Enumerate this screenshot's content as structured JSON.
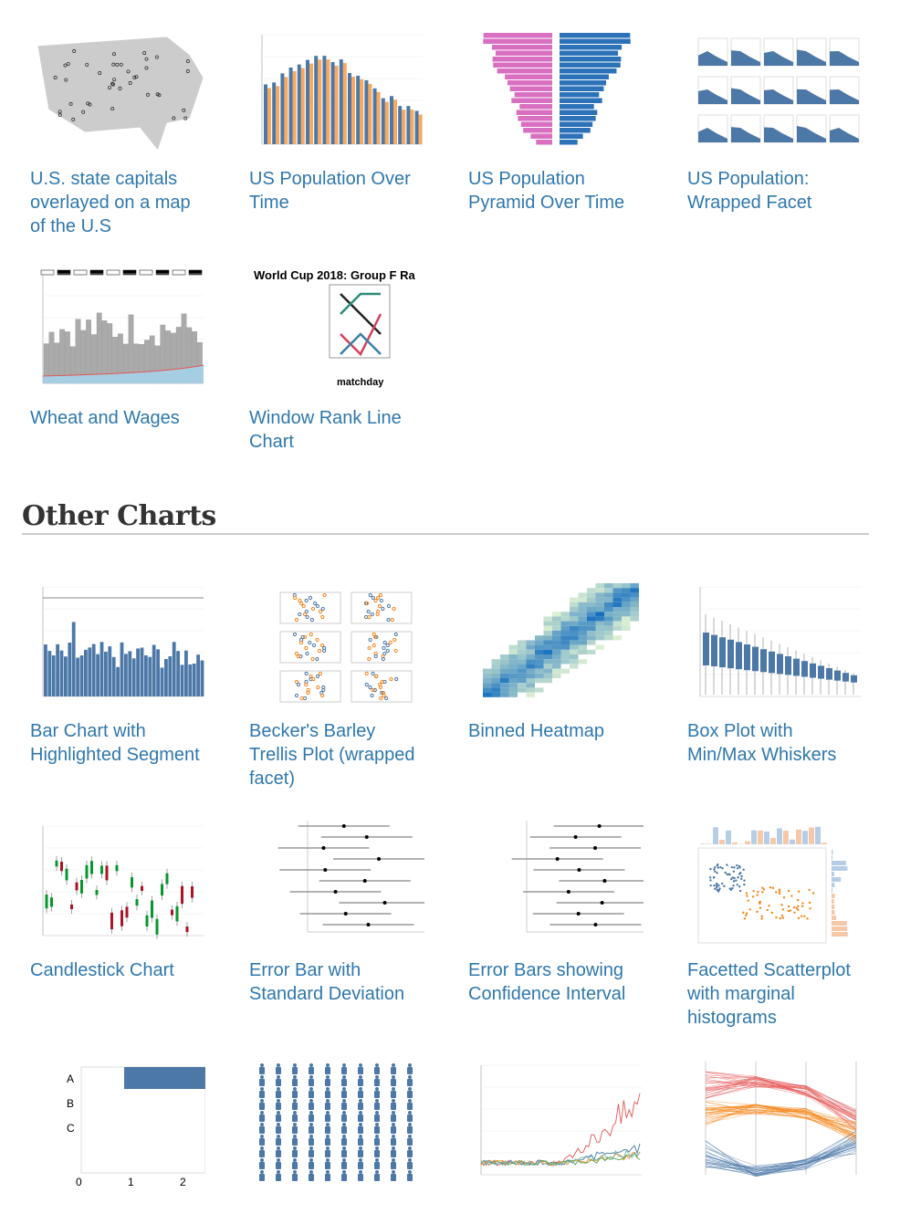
{
  "section_top": {
    "items": [
      {
        "title": "U.S. state capitals overlayed on a map of the U.S",
        "thumb": "map"
      },
      {
        "title": "US Population Over Time",
        "thumb": "grouped-bar"
      },
      {
        "title": "US Population Pyramid Over Time",
        "thumb": "pyramid"
      },
      {
        "title": "US Population: Wrapped Facet",
        "thumb": "facet-area"
      },
      {
        "title": "Wheat and Wages",
        "thumb": "wheat"
      },
      {
        "title": "Window Rank Line Chart",
        "thumb": "rank"
      }
    ]
  },
  "other": {
    "heading": "Other Charts",
    "items": [
      {
        "title": "Bar Chart with Highlighted Segment",
        "thumb": "bar"
      },
      {
        "title": "Becker's Barley Trellis Plot (wrapped facet)",
        "thumb": "trellis"
      },
      {
        "title": "Binned Heatmap",
        "thumb": "heatmap"
      },
      {
        "title": "Box Plot with Min/Max Whiskers",
        "thumb": "boxplot"
      },
      {
        "title": "Candlestick Chart",
        "thumb": "candlestick"
      },
      {
        "title": "Error Bar with Standard Deviation",
        "thumb": "errorbar"
      },
      {
        "title": "Error Bars showing Confidence Interval",
        "thumb": "errorbar"
      },
      {
        "title": "Facetted Scatterplot with marginal histograms",
        "thumb": "scatter-hist"
      },
      {
        "title": "",
        "thumb": "gantt"
      },
      {
        "title": "",
        "thumb": "isotype"
      },
      {
        "title": "",
        "thumb": "multiline"
      },
      {
        "title": "",
        "thumb": "parallel"
      }
    ]
  },
  "colors": {
    "link": "#2f78ad",
    "blue": "#4c78a8",
    "orange": "#f58518",
    "red": "#e45756",
    "pink": "#d96fc0",
    "green": "#54a24b",
    "teal": "#72b7b2"
  }
}
